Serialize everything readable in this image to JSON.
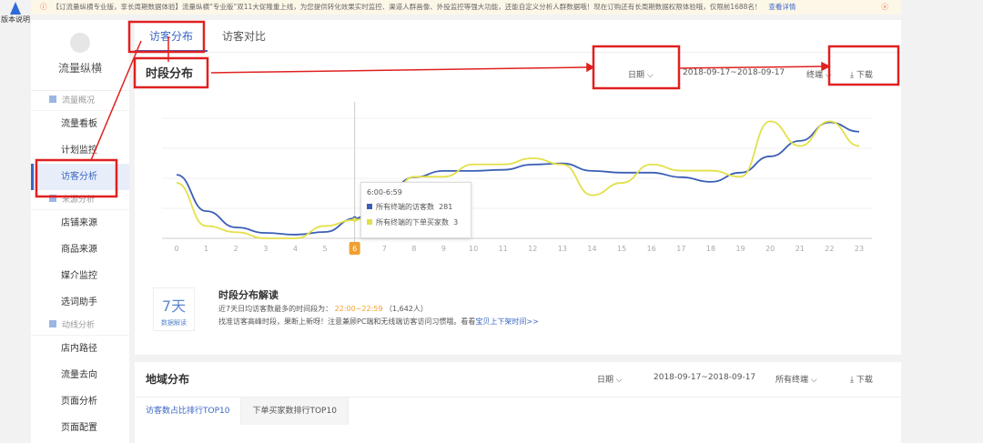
{
  "help": {
    "label": "版本说明"
  },
  "notice": {
    "text": "【订流量纵横专业版，享长周期数据体验】流量纵横“专业版”双11大促隆重上线，为您提供转化效果实时监控、渠道人群画像、外投监控等强大功能，还能自定义分析人群数据哦！现在订购还有长周期数据权限体验哦，仅限前1688名！",
    "link": "查看详情"
  },
  "sidebar": {
    "brand": "流量纵横",
    "groups": [
      {
        "label": "流量概况",
        "items": [
          "流量看板",
          "计划监控",
          "访客分析"
        ]
      },
      {
        "label": "来源分析",
        "items": [
          "店铺来源",
          "商品来源",
          "媒介监控",
          "选词助手"
        ]
      },
      {
        "label": "动线分析",
        "items": [
          "店内路径",
          "流量去向",
          "页面分析",
          "页面配置"
        ]
      }
    ],
    "active": "访客分析"
  },
  "tabs": [
    "访客分布",
    "访客对比"
  ],
  "section": {
    "title": "时段分布",
    "date_label": "日期",
    "date_range": "2018-09-17~2018-09-17",
    "terminal": "终端",
    "download": "下载"
  },
  "tooltip": {
    "time": "6:00-6:59",
    "rows": [
      {
        "label": "所有终端的访客数",
        "value": "281"
      },
      {
        "label": "所有终端的下单买家数",
        "value": "3"
      }
    ]
  },
  "interp": {
    "badge_big": "7天",
    "badge_small": "数据解读",
    "title": "时段分布解读",
    "line1_prefix": "近7天日均访客数最多的时间段为：",
    "line1_time": "22:00~22:59",
    "line1_suffix": "（1,642人）",
    "line2_prefix": "找准访客高峰时段，果断上新呀！注意兼顾PC端和无线端访客访问习惯哦。看看",
    "line2_link": "宝贝上下架时间>>"
  },
  "geo": {
    "title": "地域分布",
    "date_label": "日期",
    "date_range": "2018-09-17~2018-09-17",
    "terminal": "所有终端",
    "download": "下载",
    "tabs": [
      "访客数占比排行TOP10",
      "下单买家数排行TOP10"
    ]
  },
  "colors": {
    "visitors": "#3b5fb5",
    "buyers": "#e3e04a",
    "highlight": "#f0a030",
    "annotation": "#e02020"
  },
  "chart_data": {
    "type": "line",
    "x": [
      0,
      1,
      2,
      3,
      4,
      5,
      6,
      7,
      8,
      9,
      10,
      11,
      12,
      13,
      14,
      15,
      16,
      17,
      18,
      19,
      20,
      21,
      22,
      23
    ],
    "xlabel": "",
    "highlight_x": 6,
    "series": [
      {
        "name": "所有终端的访客数",
        "axis": "left",
        "values": [
          900,
          385,
          155,
          77,
          52,
          90,
          281,
          605,
          865,
          955,
          955,
          970,
          1045,
          1060,
          955,
          930,
          930,
          865,
          800,
          930,
          1160,
          1380,
          1642,
          1510
        ]
      },
      {
        "name": "所有终端的下单买家数",
        "axis": "right",
        "values": [
          9,
          2,
          1,
          0,
          0,
          2,
          3,
          5,
          10,
          10,
          12,
          12,
          13,
          12,
          7,
          9,
          12,
          11,
          11,
          10,
          19,
          15,
          19,
          15
        ]
      }
    ],
    "ylim_left": [
      0,
      1700
    ],
    "ylim_right": [
      0,
      19.5
    ],
    "grid": true
  }
}
